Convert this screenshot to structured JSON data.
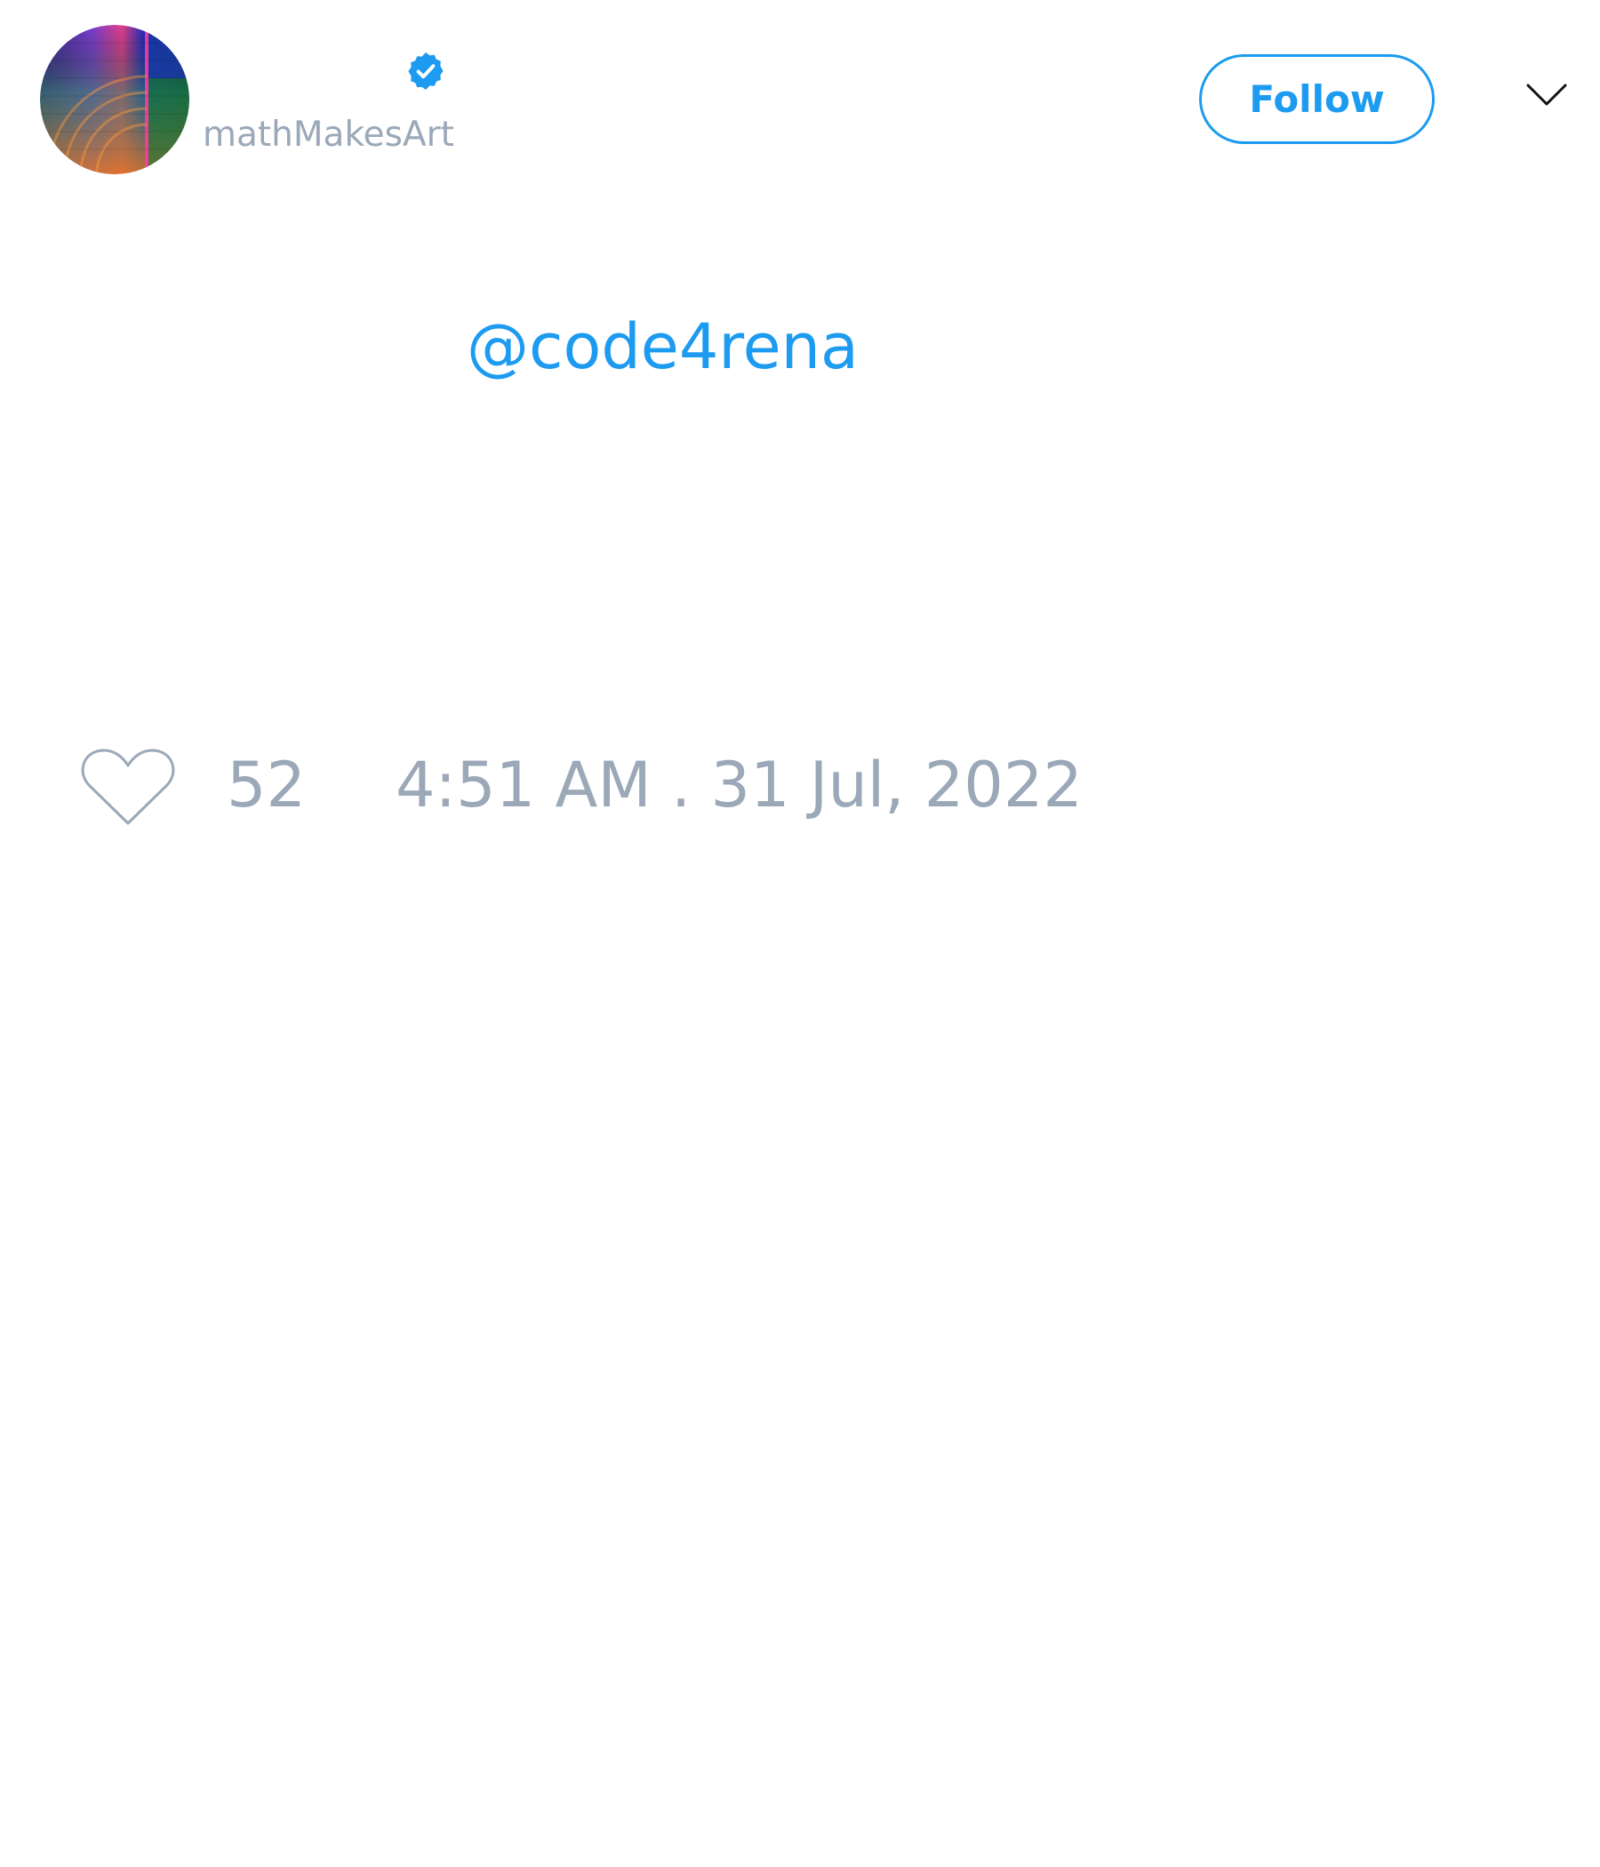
{
  "author": {
    "display_name": "",
    "handle": "mathMakesArt",
    "verified": true,
    "avatar_icon": "avatar-image",
    "verified_icon": "verified-badge-icon"
  },
  "header": {
    "follow_label": "Follow",
    "menu_icon": "chevron-down-icon"
  },
  "tweet": {
    "mention": "@code4rena"
  },
  "footer": {
    "like_icon": "heart-icon",
    "like_count": "52",
    "timestamp": "4:51 AM . 31 Jul, 2022"
  },
  "colors": {
    "accent": "#1d9bf0",
    "muted_text": "#9aa8b8",
    "background": "#ffffff"
  }
}
